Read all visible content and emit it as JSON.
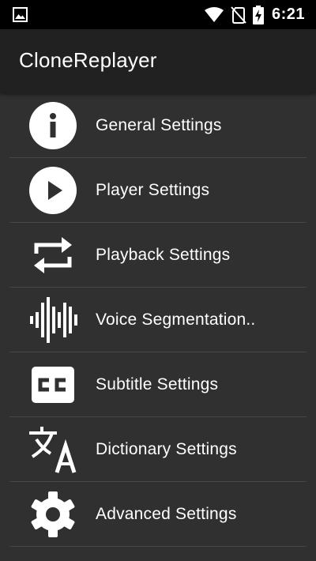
{
  "status_bar": {
    "time": "6:21",
    "icons": [
      "image-icon",
      "wifi-icon",
      "no-sim-icon",
      "battery-charging-icon"
    ]
  },
  "app_bar": {
    "title": "CloneReplayer"
  },
  "settings": [
    {
      "label": "General Settings",
      "icon": "info-icon"
    },
    {
      "label": "Player Settings",
      "icon": "play-icon"
    },
    {
      "label": "Playback Settings",
      "icon": "repeat-icon"
    },
    {
      "label": "Voice Segmentation..",
      "icon": "voice-waveform-icon"
    },
    {
      "label": "Subtitle Settings",
      "icon": "closed-caption-icon"
    },
    {
      "label": "Dictionary Settings",
      "icon": "translate-icon"
    },
    {
      "label": "Advanced Settings",
      "icon": "gear-icon"
    }
  ],
  "colors": {
    "status_bar": "#000000",
    "app_bar": "#212121",
    "background": "#303030",
    "divider": "#474747",
    "text": "#ffffff"
  }
}
